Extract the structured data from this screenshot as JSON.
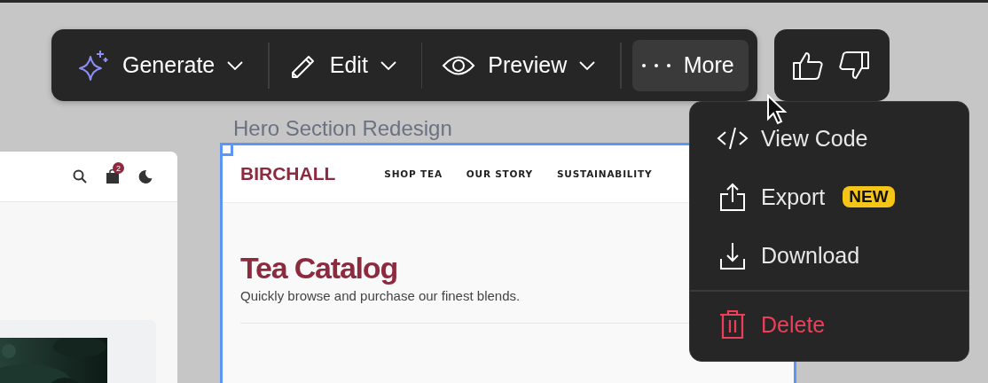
{
  "toolbar": {
    "items": [
      {
        "label": "Generate",
        "dropdown": true,
        "selected": false
      },
      {
        "label": "Edit",
        "dropdown": true,
        "selected": false
      },
      {
        "label": "Preview",
        "dropdown": true,
        "selected": false
      },
      {
        "label": "More",
        "dropdown": false,
        "selected": true
      }
    ]
  },
  "side_frame": {
    "cart_count": "2"
  },
  "frame": {
    "title": "Hero Section Redesign",
    "selected": true,
    "brand": "BIRCHALL",
    "nav": [
      "SHOP TEA",
      "OUR STORY",
      "SUSTAINABILITY"
    ],
    "heading": "Tea Catalog",
    "subheading": "Quickly browse and purchase our finest blends."
  },
  "menu": {
    "items": [
      {
        "label": "View Code",
        "kind": "normal"
      },
      {
        "label": "Export",
        "kind": "normal",
        "badge": "NEW"
      },
      {
        "label": "Download",
        "kind": "normal"
      },
      {
        "label": "Delete",
        "kind": "danger"
      }
    ]
  }
}
